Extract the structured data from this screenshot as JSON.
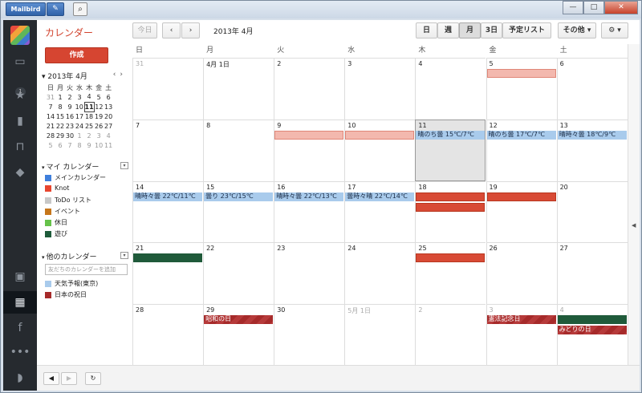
{
  "titlebar": {
    "app_label": "Mailbird",
    "pen_icon": "pencil-icon",
    "search_icon": "search-icon"
  },
  "window": {
    "minimize": "—",
    "maximize": "□",
    "close": "✕"
  },
  "sidebar": {
    "inbox_badge": "1"
  },
  "app": {
    "title": "カレンダー",
    "create_label": "作成"
  },
  "mini_cal": {
    "month_label": "2013年 4月",
    "prev": "‹",
    "next": "›",
    "headers": [
      "日",
      "月",
      "火",
      "水",
      "木",
      "金",
      "土"
    ],
    "weeks": [
      [
        "31",
        "1",
        "2",
        "3",
        "4",
        "5",
        "6"
      ],
      [
        "7",
        "8",
        "9",
        "10",
        "11",
        "12",
        "13"
      ],
      [
        "14",
        "15",
        "16",
        "17",
        "18",
        "19",
        "20"
      ],
      [
        "21",
        "22",
        "23",
        "24",
        "25",
        "26",
        "27"
      ],
      [
        "28",
        "29",
        "30",
        "1",
        "2",
        "3",
        "4"
      ],
      [
        "5",
        "6",
        "7",
        "8",
        "9",
        "10",
        "11"
      ]
    ]
  },
  "my_calendars": {
    "label": "マイ カレンダー",
    "items": [
      {
        "name": "メインカレンダー",
        "color": "#3f7fdc"
      },
      {
        "name": "Knot",
        "color": "#e8452e"
      },
      {
        "name": "ToDo リスト",
        "color": "#c8c8c8"
      },
      {
        "name": "イベント",
        "color": "#c6761b"
      },
      {
        "name": "休日",
        "color": "#66c24a"
      },
      {
        "name": "遊び",
        "color": "#1e5b3a"
      }
    ]
  },
  "other_calendars": {
    "label": "他のカレンダー",
    "add_placeholder": "友だちのカレンダーを追加",
    "items": [
      {
        "name": "天気予報(東京)",
        "color": "#a9cbec"
      },
      {
        "name": "日本の祝日",
        "color": "#a62a2a"
      }
    ]
  },
  "toolbar": {
    "today": "今日",
    "prev": "‹",
    "next": "›",
    "date_range": "2013年 4月",
    "views": [
      "日",
      "週",
      "月",
      "3日",
      "予定リスト"
    ],
    "more": "その他",
    "settings_icon": "gear-icon"
  },
  "grid": {
    "weekday_headers": [
      "日",
      "月",
      "火",
      "水",
      "木",
      "金",
      "土"
    ],
    "weeks": [
      [
        "31",
        "4月 1日",
        "2",
        "3",
        "4",
        "5",
        "6"
      ],
      [
        "7",
        "8",
        "9",
        "10",
        "11",
        "12",
        "13"
      ],
      [
        "14",
        "15",
        "16",
        "17",
        "18",
        "19",
        "20"
      ],
      [
        "21",
        "22",
        "23",
        "24",
        "25",
        "26",
        "27"
      ],
      [
        "28",
        "29",
        "30",
        "5月 1日",
        "2",
        "3",
        "4"
      ]
    ],
    "events": {
      "w1_thu": "晴のち曇 15℃/7℃",
      "w1_fri": "晴のち曇 17℃/7℃",
      "w1_sat": "晴時々曇 18℃/9℃",
      "w2_sun": "晴時々曇 22℃/11℃",
      "w2_mon": "曇り 23℃/15℃",
      "w2_tue": "晴時々曇 22℃/13℃",
      "w2_wed": "曇時々晴 22℃/14℃",
      "w4_mon": "昭和の日",
      "w4_fri": "憲法記念日",
      "w4_sat": "みどりの日"
    }
  }
}
